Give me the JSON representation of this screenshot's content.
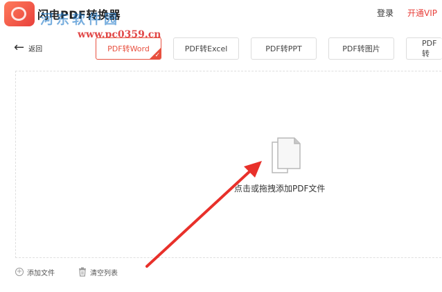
{
  "header": {
    "app_title": "闪电PDF转换器",
    "login_label": "登录",
    "vip_label": "开通VIP"
  },
  "watermark": {
    "site_name": "河东软件园",
    "site_url": "www.pc0359.cn"
  },
  "nav": {
    "back_label": "返回"
  },
  "tabs": [
    {
      "label": "PDF转Word",
      "active": true
    },
    {
      "label": "PDF转Excel",
      "active": false
    },
    {
      "label": "PDF转PPT",
      "active": false
    },
    {
      "label": "PDF转图片",
      "active": false
    },
    {
      "label": "PDF转",
      "active": false
    }
  ],
  "dropzone": {
    "label": "点击或拖拽添加PDF文件"
  },
  "footer": {
    "add_file_label": "添加文件",
    "clear_list_label": "清空列表"
  },
  "colors": {
    "accent": "#e8503f",
    "annotation_arrow": "#e8302a"
  }
}
